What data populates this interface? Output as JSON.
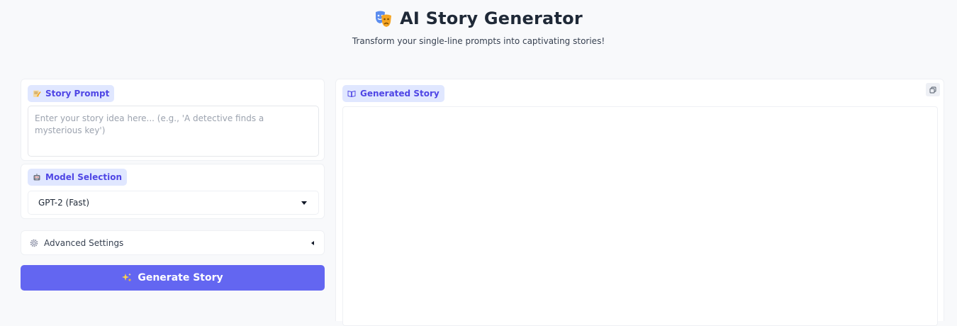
{
  "header": {
    "title": "AI Story Generator",
    "title_icon": "theater-masks-icon",
    "subtitle": "Transform your single-line prompts into captivating stories!"
  },
  "prompt": {
    "label": "Story Prompt",
    "icon": "memo-icon",
    "value": "",
    "placeholder": "Enter your story idea here... (e.g., 'A detective finds a mysterious key')"
  },
  "model": {
    "label": "Model Selection",
    "icon": "robot-icon",
    "selected": "GPT-2 (Fast)"
  },
  "advanced": {
    "label": "Advanced Settings",
    "icon": "gear-icon"
  },
  "actions": {
    "generate_label": "Generate Story",
    "generate_icon": "sparkles-icon"
  },
  "output": {
    "label": "Generated Story",
    "icon": "book-icon",
    "value": "",
    "copy_icon": "copy-icon"
  },
  "colors": {
    "accent": "#6366f1",
    "pill_bg": "#e0e7ff",
    "pill_text": "#4f46e5",
    "page_bg": "#f8f9fb"
  }
}
